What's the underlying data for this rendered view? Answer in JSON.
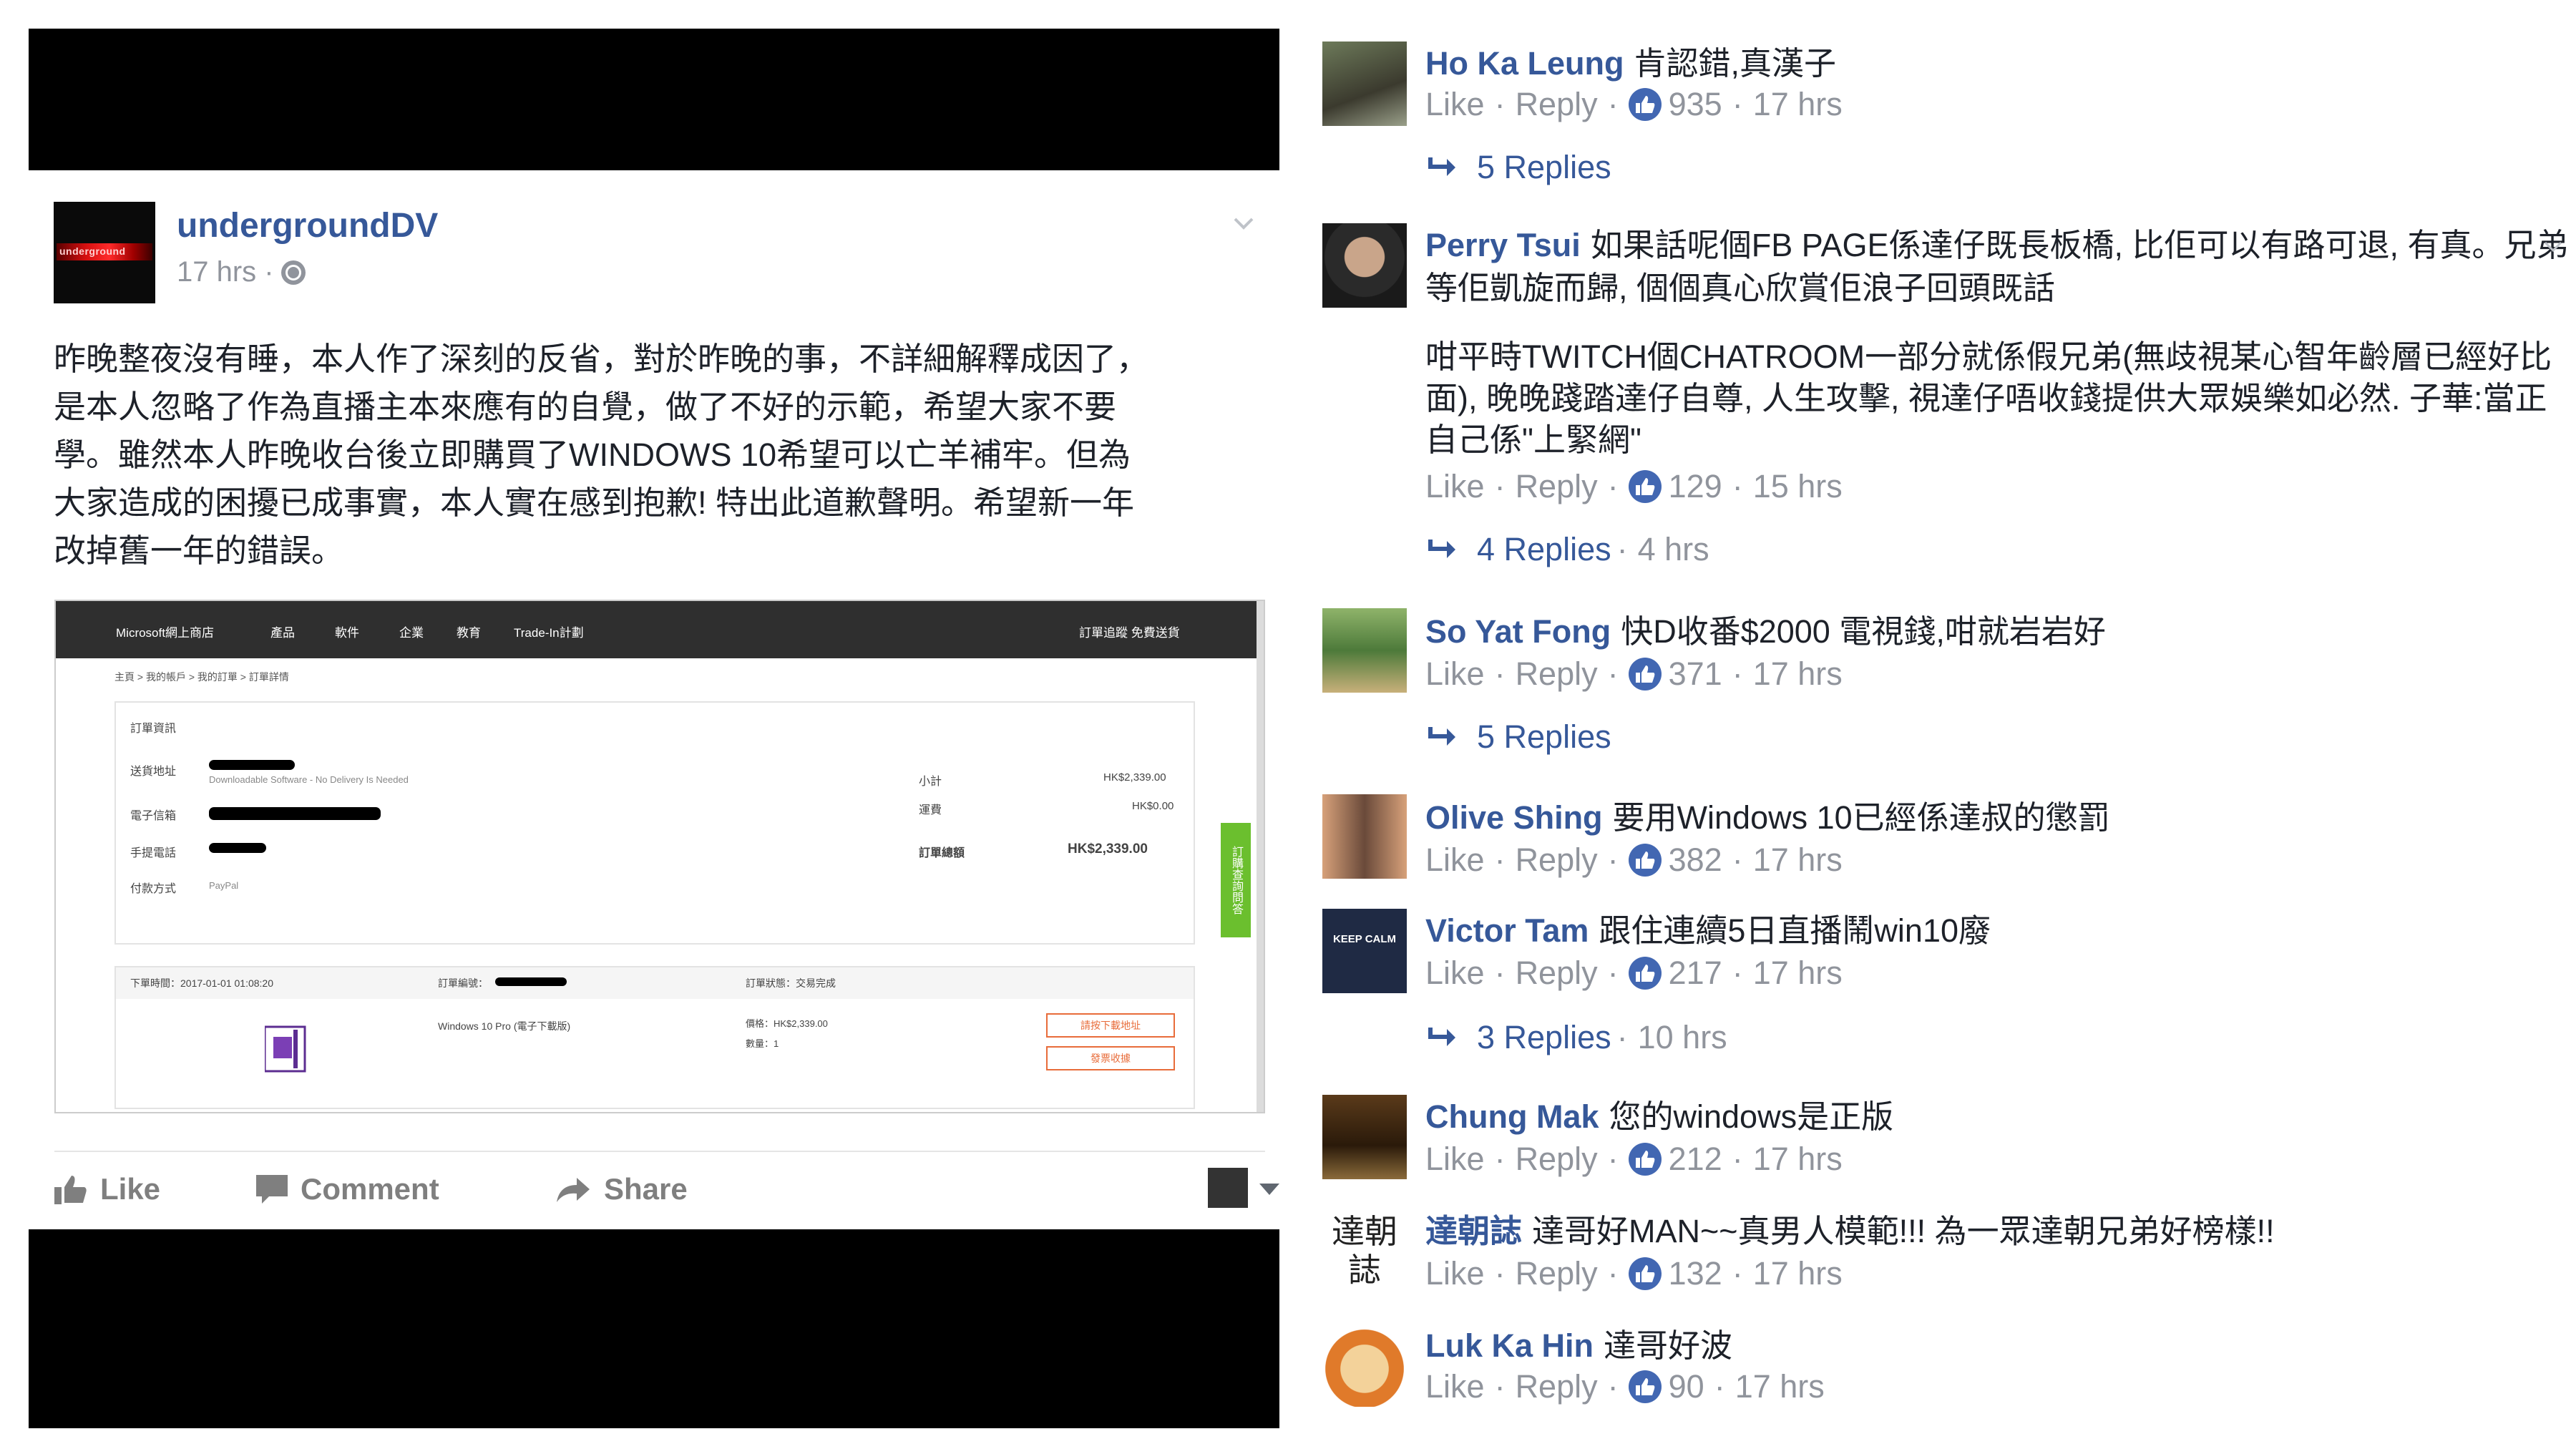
{
  "post": {
    "page_name": "undergroundDV",
    "time": "17 hrs ·",
    "avatar_text": "underground",
    "text_lines": [
      "昨晚整夜沒有睡，本人作了深刻的反省，對於昨晚的事，不詳細解釋成因了，",
      "是本人忽略了作為直播主本來應有的自覺，做了不好的示範，希望大家不要",
      "學。雖然本人昨晚收台後立即購買了WINDOWS 10希望可以亡羊補牢。但為",
      "大家造成的困擾已成事實，本人實在感到抱歉! 特出此道歉聲明。希望新一年",
      "改掉舊一年的錯誤。"
    ],
    "actions": {
      "like": "Like",
      "comment": "Comment",
      "share": "Share"
    }
  },
  "screenshot": {
    "store_name": "Microsoft網上商店",
    "nav_items": [
      "產品",
      "軟件",
      "企業",
      "教育",
      "Trade-In計劃"
    ],
    "nav_right": "訂單追蹤  免費送貨",
    "breadcrumb": "主頁 > 我的帳戶 > 我的訂單 > 訂單詳情",
    "section_title": "訂單資訊",
    "labels": [
      "送貨地址",
      "電子信箱",
      "手提電話",
      "付款方式"
    ],
    "delivery": "Downloadable Software - No Delivery Is Needed",
    "payment": "PayPal",
    "subtotal_label": "小計",
    "subtotal": "HK$2,339.00",
    "shipping_label": "運費",
    "shipping": "HK$0.00",
    "total_label": "訂單總額",
    "total": "HK$2,339.00",
    "order_date": "下單時間：2017-01-01 01:08:20",
    "order_no": "訂單編號：",
    "order_status": "訂單狀態：交易完成",
    "product": "Windows 10 Pro (電子下載版)",
    "price_line": "價格：HK$2,339.00",
    "qty_line": "數量：1",
    "btn1": "請按下載地址",
    "btn2": "發票收據",
    "side_tab": "訂購查詢問答"
  },
  "comments": [
    {
      "name": "Ho Ka Leung",
      "lines": [
        "肯認錯,真漢子"
      ],
      "likes": "935",
      "time": "17 hrs",
      "replies": "5 Replies",
      "replies_time": ""
    },
    {
      "name": "Perry Tsui",
      "lines": [
        "如果話呢個FB PAGE係達仔既長板橋, 比佢可以有路可退, 有真。兄弟",
        "等佢凱旋而歸, 個個真心欣賞佢浪子回頭既話",
        "",
        "咁平時TWITCH個CHATROOM一部分就係假兄弟(無歧視某心智年齡層已經好比",
        "面), 晚晚踐踏達仔自尊, 人生攻擊, 視達仔唔收錢提供大眾娛樂如必然. 子華:當正",
        "自己係\"上緊網\""
      ],
      "likes": "129",
      "time": "15 hrs",
      "replies": "4 Replies",
      "replies_time": "4 hrs"
    },
    {
      "name": "So Yat Fong",
      "lines": [
        "快D收番$2000 電視錢,咁就岩岩好"
      ],
      "likes": "371",
      "time": "17 hrs",
      "replies": "5 Replies",
      "replies_time": ""
    },
    {
      "name": "Olive Shing",
      "lines": [
        "要用Windows 10已經係達叔的懲罰"
      ],
      "likes": "382",
      "time": "17 hrs",
      "replies": "",
      "replies_time": ""
    },
    {
      "name": "Victor Tam",
      "lines": [
        "跟住連續5日直播鬧win10廢"
      ],
      "likes": "217",
      "time": "17 hrs",
      "replies": "3 Replies",
      "replies_time": "10 hrs"
    },
    {
      "name": "Chung Mak",
      "lines": [
        "您的windows是正版"
      ],
      "likes": "212",
      "time": "17 hrs",
      "replies": "",
      "replies_time": ""
    },
    {
      "name": "達朝誌",
      "lines": [
        "達哥好MAN~~真男人模範!!! 為一眾達朝兄弟好榜樣!!"
      ],
      "likes": "132",
      "time": "17 hrs",
      "replies": "",
      "replies_time": ""
    },
    {
      "name": "Luk Ka Hin",
      "lines": [
        "達哥好波"
      ],
      "likes": "90",
      "time": "17 hrs",
      "replies": "",
      "replies_time": ""
    }
  ],
  "comment_ui": {
    "like": "Like",
    "reply": "Reply",
    "sep": "·"
  },
  "avatar_text": {
    "victor": "KEEP CALM",
    "dazhao": "達朝誌"
  },
  "colors": {
    "link_blue": "#365899",
    "meta_grey": "#90949c",
    "like_blue": "#4267b2"
  }
}
